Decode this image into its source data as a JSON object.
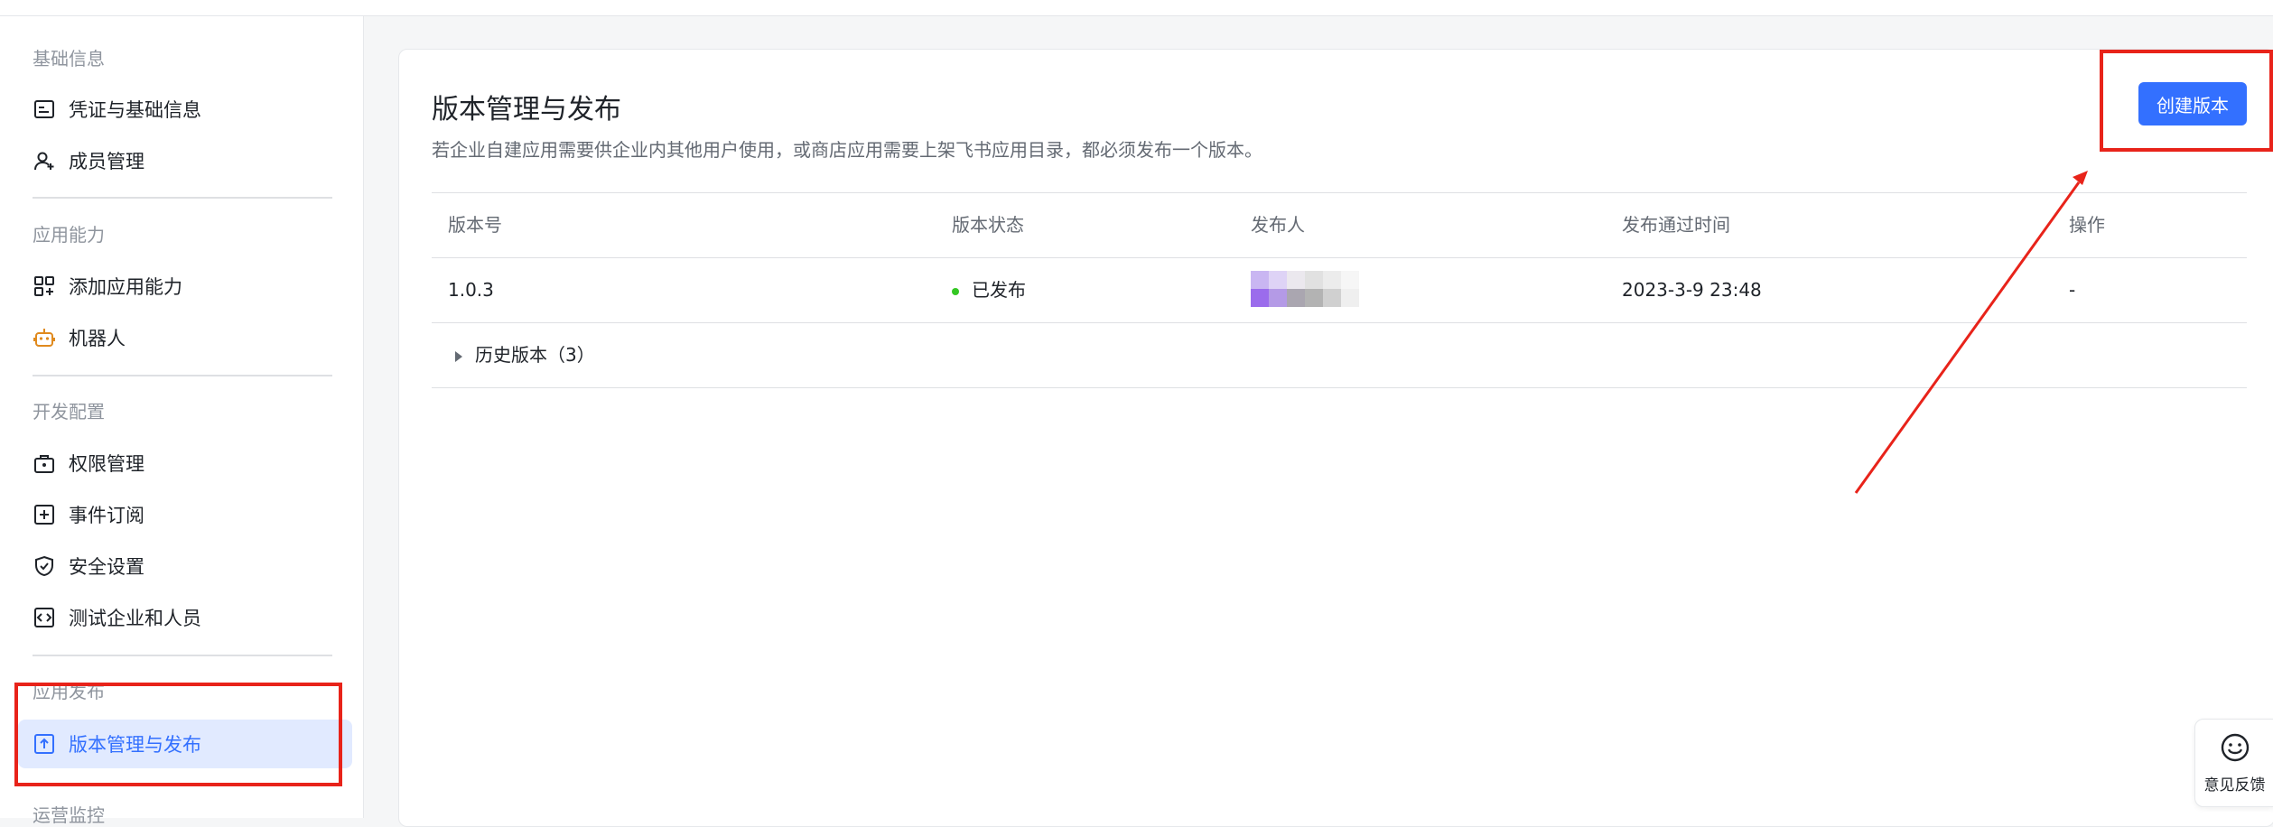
{
  "sidebar": {
    "sections": [
      {
        "title": "基础信息",
        "items": [
          {
            "label": "凭证与基础信息",
            "icon": "credential-icon"
          },
          {
            "label": "成员管理",
            "icon": "member-add-icon"
          }
        ]
      },
      {
        "title": "应用能力",
        "items": [
          {
            "label": "添加应用能力",
            "icon": "grid-plus-icon"
          },
          {
            "label": "机器人",
            "icon": "robot-icon"
          }
        ]
      },
      {
        "title": "开发配置",
        "items": [
          {
            "label": "权限管理",
            "icon": "lock-case-icon"
          },
          {
            "label": "事件订阅",
            "icon": "plus-square-icon"
          },
          {
            "label": "安全设置",
            "icon": "shield-check-icon"
          },
          {
            "label": "测试企业和人员",
            "icon": "code-box-icon"
          }
        ]
      },
      {
        "title": "应用发布",
        "items": [
          {
            "label": "版本管理与发布",
            "icon": "upload-box-icon"
          }
        ]
      },
      {
        "title": "运营监控"
      }
    ],
    "active_item": "版本管理与发布"
  },
  "main": {
    "title": "版本管理与发布",
    "description": "若企业自建应用需要供企业内其他用户使用，或商店应用需要上架飞书应用目录，都必须发布一个版本。",
    "create_button": "创建版本",
    "table": {
      "headers": [
        "版本号",
        "版本状态",
        "发布人",
        "发布通过时间",
        "操作"
      ],
      "rows": [
        {
          "version": "1.0.3",
          "status": "已发布",
          "publisher": "",
          "time": "2023-3-9 23:48",
          "action": "-"
        }
      ],
      "history_label": "历史版本（3）"
    }
  },
  "feedback": {
    "label": "意见反馈",
    "icon": "smile-icon"
  },
  "colors": {
    "accent": "#3370ff",
    "active_bg": "#e1eaff",
    "status_green": "#34c724",
    "annotation_red": "#e8231a"
  }
}
